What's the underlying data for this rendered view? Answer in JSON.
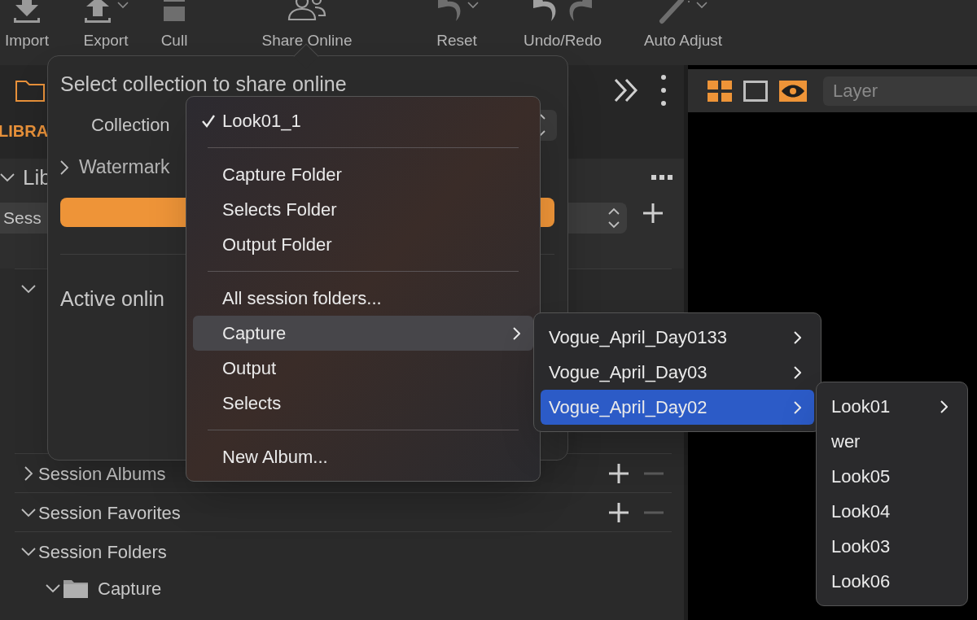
{
  "toolbar": {
    "items": [
      {
        "label": "Import",
        "dropdown": false
      },
      {
        "label": "Export",
        "dropdown": true
      },
      {
        "label": "Cull",
        "dropdown": false
      },
      {
        "label": "Share Online",
        "dropdown": false
      },
      {
        "label": "Reset",
        "dropdown": true
      },
      {
        "label": "Undo/Redo",
        "dropdown": false
      },
      {
        "label": "Auto Adjust",
        "dropdown": true
      }
    ]
  },
  "library_panel": {
    "tab_label": "LIBRA",
    "group_label": "Lib",
    "session_select": "Sess",
    "sections": [
      {
        "expanded": true,
        "buttons": false
      },
      {
        "label": "Session Albums",
        "expanded": false,
        "buttons": true
      },
      {
        "label": "Session Favorites",
        "expanded": true,
        "buttons": true
      },
      {
        "label": "Session Folders",
        "expanded": true,
        "buttons": false
      }
    ],
    "folders": [
      {
        "label": "Capture",
        "expanded": true
      }
    ]
  },
  "viewer": {
    "layer_placeholder": "Layer"
  },
  "share_popover": {
    "title": "Select collection to share online",
    "collection_label": "Collection",
    "watermark_label": "Watermark",
    "watermark_expanded": false,
    "active_label": "Active onlin"
  },
  "menus": [
    {
      "items": [
        {
          "kind": "item",
          "label": "Look01_1",
          "checked": true,
          "selected": false
        },
        {
          "kind": "separator"
        },
        {
          "kind": "item",
          "label": "Capture Folder",
          "checked": false,
          "selected": false
        },
        {
          "kind": "item",
          "label": "Selects Folder",
          "checked": false,
          "selected": false
        },
        {
          "kind": "item",
          "label": "Output Folder",
          "checked": false,
          "selected": false
        },
        {
          "kind": "separator"
        },
        {
          "kind": "item",
          "label": "All session folders...",
          "checked": false,
          "selected": false
        },
        {
          "kind": "submenu",
          "label": "Capture",
          "checked": false,
          "selected": true
        },
        {
          "kind": "item",
          "label": "Output",
          "checked": false,
          "selected": false
        },
        {
          "kind": "item",
          "label": "Selects",
          "checked": false,
          "selected": false
        },
        {
          "kind": "separator"
        },
        {
          "kind": "item",
          "label": "New Album...",
          "checked": false,
          "selected": false
        }
      ]
    },
    {
      "items": [
        {
          "kind": "submenu",
          "label": "Vogue_April_Day0133",
          "selected": false
        },
        {
          "kind": "submenu",
          "label": "Vogue_April_Day03",
          "selected": false
        },
        {
          "kind": "submenu",
          "label": "Vogue_April_Day02",
          "selected": true
        }
      ]
    },
    {
      "items": [
        {
          "kind": "submenu",
          "label": "Look01",
          "selected": false
        },
        {
          "kind": "item",
          "label": "wer",
          "selected": false
        },
        {
          "kind": "item",
          "label": "Look05",
          "selected": false
        },
        {
          "kind": "item",
          "label": "Look04",
          "selected": false
        },
        {
          "kind": "item",
          "label": "Look03",
          "selected": false
        },
        {
          "kind": "item",
          "label": "Look06",
          "selected": false
        }
      ]
    }
  ]
}
